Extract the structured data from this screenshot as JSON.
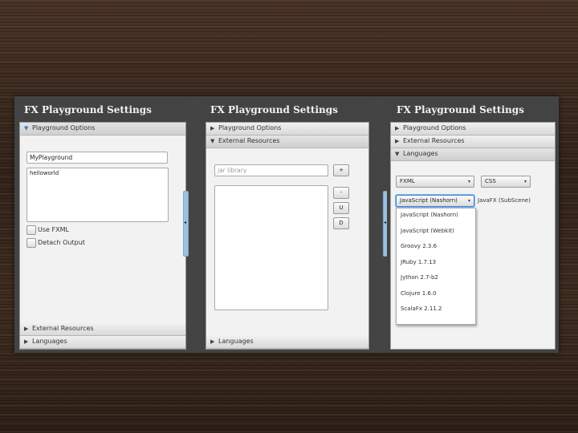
{
  "panel1": {
    "title": "FX Playground Settings",
    "sections": [
      "Playground Options",
      "External Resources",
      "Languages"
    ],
    "name_value": "MyPlayground",
    "text_value": "helloworld",
    "checkbox_fxml": "Use FXML",
    "checkbox_detach": "Detach Output"
  },
  "panel2": {
    "title": "FX Playground Settings",
    "sections": [
      "Playground Options",
      "External Resources",
      "Languages"
    ],
    "jar_placeholder": "jar library",
    "btn_add": "+",
    "btn_remove": "-",
    "btn_up": "U",
    "btn_down": "D"
  },
  "panel3": {
    "title": "FX Playground Settings",
    "sections": [
      "Playground Options",
      "External Resources",
      "Languages"
    ],
    "combo_fxml": "FXML",
    "combo_css": "CSS",
    "combo_lang": "JavaScript (Nashorn)",
    "javafx_label": "JavaFX (SubScene)",
    "options": [
      "JavaScript (Nashorn)",
      "JavaScript (Webkit)",
      "Groovy 2.3.6",
      "JRuby 1.7.13",
      "Jython 2.7-b2",
      "Clojure 1.6.0",
      "ScalaFx 2.11.2"
    ]
  }
}
